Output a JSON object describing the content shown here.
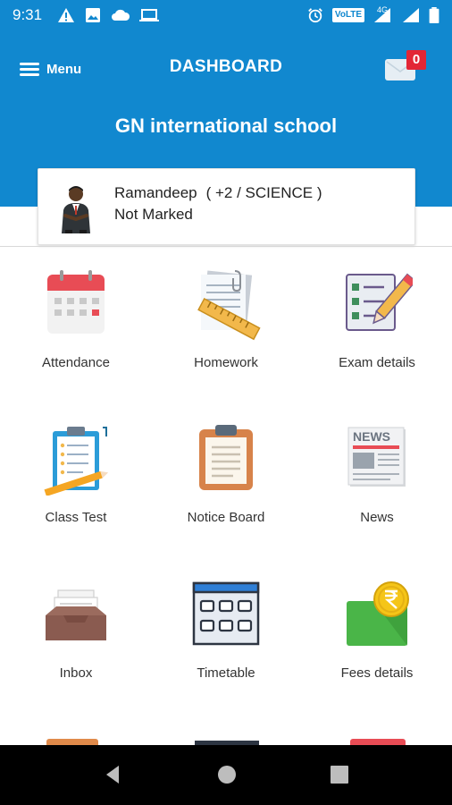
{
  "status_bar": {
    "time": "9:31",
    "network_label": "VoLTE",
    "network_gen": "4G",
    "icons": [
      "warning-icon",
      "image-icon",
      "cloud-icon",
      "laptop-icon",
      "alarm-icon",
      "volte-icon",
      "signal-icon",
      "battery-icon"
    ]
  },
  "header": {
    "menu_label": "Menu",
    "title": "DASHBOARD",
    "school_name": "GN international school",
    "message_count": "0",
    "background": "#1188cf"
  },
  "student": {
    "name": "Ramandeep",
    "class": "( +2 / SCIENCE )",
    "attendance_status": "Not Marked"
  },
  "modules": [
    {
      "label": "Attendance",
      "icon": "calendar-icon"
    },
    {
      "label": "Homework",
      "icon": "homework-icon"
    },
    {
      "label": "Exam details",
      "icon": "exam-icon"
    },
    {
      "label": "Class Test",
      "icon": "clipboard-test-icon"
    },
    {
      "label": "Notice Board",
      "icon": "notice-board-icon"
    },
    {
      "label": "News",
      "icon": "newspaper-icon"
    },
    {
      "label": "Inbox",
      "icon": "inbox-tray-icon"
    },
    {
      "label": "Timetable",
      "icon": "timetable-icon"
    },
    {
      "label": "Fees details",
      "icon": "wallet-coin-icon"
    }
  ],
  "newspaper_word": "NEWS",
  "nav_bar": {
    "buttons": [
      "back-icon",
      "home-icon",
      "recents-icon"
    ]
  }
}
